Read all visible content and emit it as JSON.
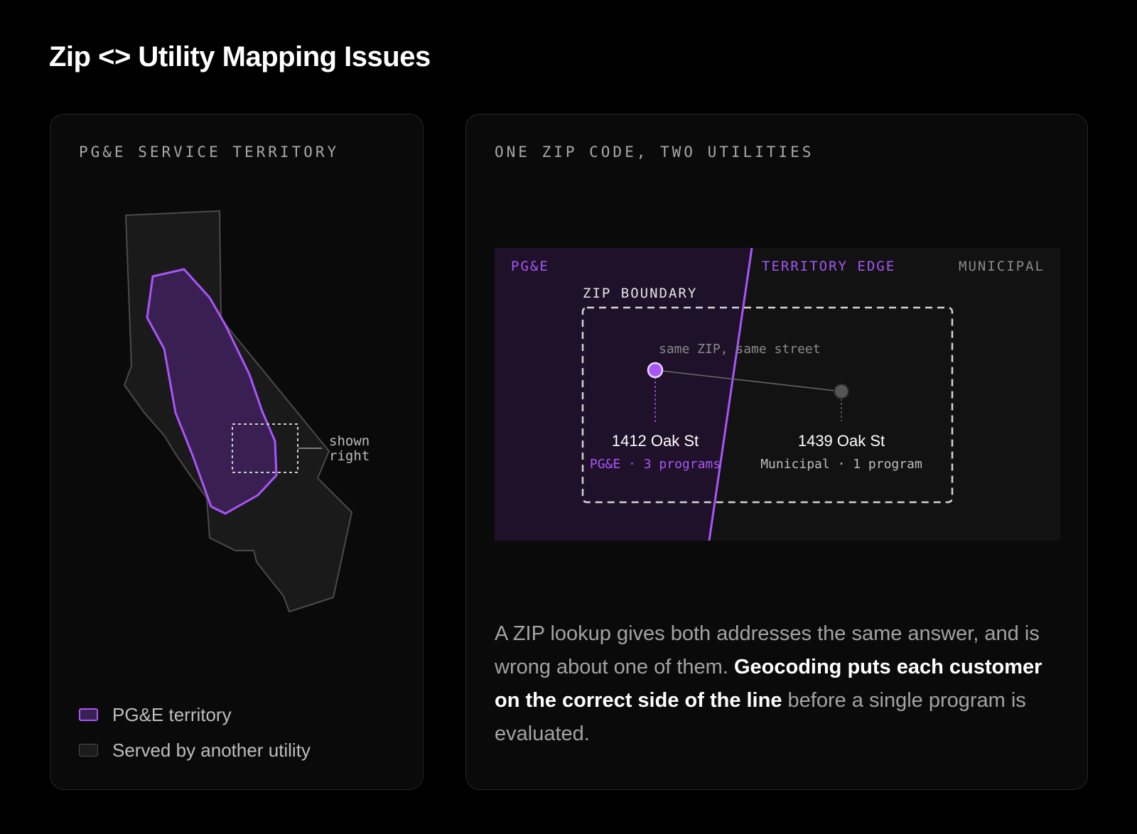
{
  "title": "Zip <> Utility Mapping Issues",
  "left_panel": {
    "label": "PG&E SERVICE TERRITORY",
    "callout": [
      "shown",
      "right"
    ],
    "legend": [
      {
        "label": "PG&E territory"
      },
      {
        "label": "Served by another utility"
      }
    ]
  },
  "right_panel": {
    "label": "ONE ZIP CODE, TWO UTILITIES",
    "zone_labels": {
      "left": "PG&E",
      "edge": "TERRITORY EDGE",
      "right": "MUNICIPAL"
    },
    "zip_boundary_label": "ZIP BOUNDARY",
    "connector_label": "same ZIP, same street",
    "addresses": [
      {
        "street": "1412 Oak St",
        "detail": "PG&E · 3 programs"
      },
      {
        "street": "1439 Oak St",
        "detail": "Municipal · 1 program"
      }
    ],
    "description": {
      "lead": "A ZIP lookup gives both addresses the same answer, and is wrong about one of them. ",
      "emphasis": "Geocoding puts each customer on the correct side of the line",
      "tail": " before a single program is evaluated."
    }
  },
  "colors": {
    "background": "#000000",
    "card": "#0a0a0a",
    "accent": "#a855f7",
    "pge_fill": "#3a2052",
    "pge_zone": "#1f1129",
    "muted": "#a3a3a3"
  }
}
